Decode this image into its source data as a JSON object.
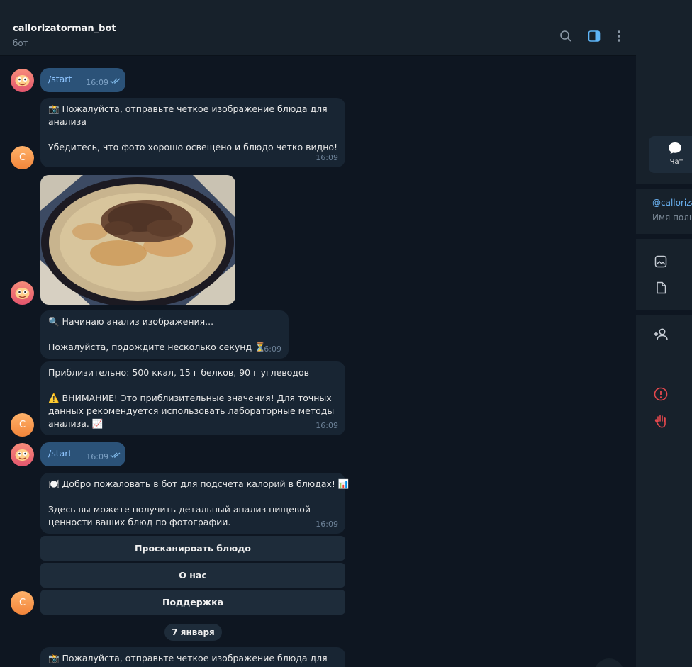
{
  "header": {
    "title": "callorizatorman_bot",
    "subtitle": "бот"
  },
  "messages": {
    "m1": {
      "text": "/start",
      "time": "16:09"
    },
    "m2": {
      "lines": [
        "📸 Пожалуйста, отправьте четкое изображение блюда для",
        "анализа",
        "",
        "Убедитесь, что фото хорошо освещено и блюдо четко видно!"
      ],
      "time": "16:09",
      "avatar": "C"
    },
    "m4": {
      "lines": [
        "🔍 Начинаю анализ изображения...",
        "",
        "Пожалуйста, подождите несколько секунд ⏳"
      ],
      "time": "16:09"
    },
    "m5": {
      "lines": [
        "Приблизительно: 500 ккал, 15 г белков, 90 г углеводов",
        "",
        "⚠️ ВНИМАНИЕ! Это приблизительные значения! Для точных",
        "данных рекомендуется использовать лабораторные методы",
        "анализа. 📈"
      ],
      "time": "16:09",
      "avatar": "C"
    },
    "m6": {
      "text": "/start",
      "time": "16:09"
    },
    "m7": {
      "lines": [
        "🍽️ Добро пожаловать в бот для подсчета калорий в блюдах! 📊",
        "",
        "Здесь вы можете получить детальный анализ пищевой",
        "ценности ваших блюд по фотографии."
      ],
      "time": "16:09"
    },
    "buttons": [
      "Просканироать блюдо",
      "О нас",
      "Поддержка"
    ],
    "button_avatar": "C",
    "date_divider": "7 января",
    "m8": {
      "lines": [
        "📸 Пожалуйста, отправьте четкое изображение блюда для"
      ]
    }
  },
  "right_panel": {
    "chat_button": "Чат",
    "username": "@callorizat",
    "username_label": "Имя поль"
  },
  "icons": [
    "search-icon",
    "sidebar-toggle-icon",
    "more-vertical-icon",
    "chat-bubble-icon",
    "image-icon",
    "file-icon",
    "add-user-icon",
    "report-icon",
    "block-hand-icon",
    "double-check-icon"
  ],
  "colors": {
    "background": "#0e1621",
    "panel": "#17212b",
    "bubble_in": "#182533",
    "bubble_out": "#2b5278",
    "accent": "#5eb5f7",
    "danger": "#e5484d"
  }
}
